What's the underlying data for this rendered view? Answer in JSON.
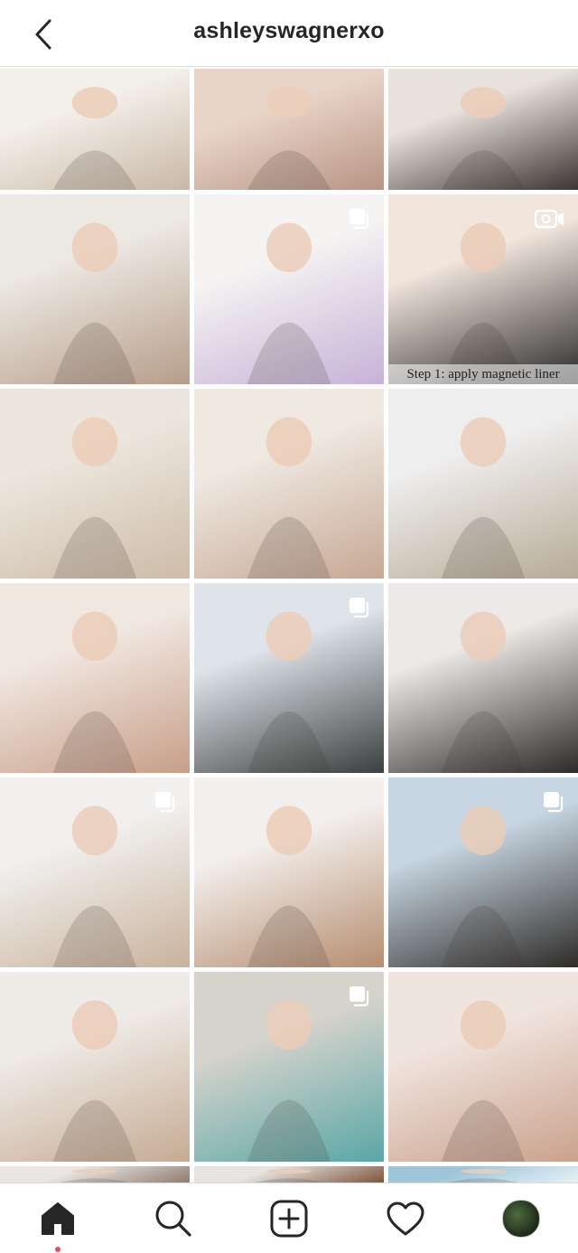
{
  "header": {
    "username": "ashleyswagnerxo",
    "back_icon": "chevron-left-icon"
  },
  "grid": {
    "tiles": [
      {
        "name": "post-1",
        "colors": [
          "#f3efe9",
          "#c9b8a6"
        ],
        "badge": null
      },
      {
        "name": "post-2",
        "colors": [
          "#e9d5c8",
          "#b89484"
        ],
        "badge": null
      },
      {
        "name": "post-3",
        "colors": [
          "#e8e2dc",
          "#3b3533"
        ],
        "badge": null
      },
      {
        "name": "post-4",
        "colors": [
          "#ece8e2",
          "#b79d8a"
        ],
        "badge": null
      },
      {
        "name": "post-5",
        "colors": [
          "#f5f4f2",
          "#c7b2d8"
        ],
        "badge": "multiple-posts-icon"
      },
      {
        "name": "post-6",
        "colors": [
          "#f1e5dc",
          "#2b2b2b"
        ],
        "badge": "video-icon",
        "caption": "Step 1: apply magnetic liner"
      },
      {
        "name": "post-7",
        "colors": [
          "#ede6de",
          "#cdbca8"
        ],
        "badge": null
      },
      {
        "name": "post-8",
        "colors": [
          "#efe9e2",
          "#c7a894"
        ],
        "badge": null
      },
      {
        "name": "post-9",
        "colors": [
          "#efeeee",
          "#b7ab96"
        ],
        "badge": null
      },
      {
        "name": "post-10",
        "colors": [
          "#f1e7e1",
          "#c79f88"
        ],
        "badge": null
      },
      {
        "name": "post-11",
        "colors": [
          "#dfe4ea",
          "#3b3f3f"
        ],
        "badge": "multiple-posts-icon"
      },
      {
        "name": "post-12",
        "colors": [
          "#ece9e8",
          "#2d2a28"
        ],
        "badge": null
      },
      {
        "name": "post-13",
        "colors": [
          "#f1f0ee",
          "#c9b29c"
        ],
        "badge": "multiple-posts-icon"
      },
      {
        "name": "post-14",
        "colors": [
          "#f3efec",
          "#b68e70"
        ],
        "badge": null
      },
      {
        "name": "post-15",
        "colors": [
          "#c7d6e2",
          "#2f2c29"
        ],
        "badge": "multiple-posts-icon"
      },
      {
        "name": "post-16",
        "colors": [
          "#efebe7",
          "#c6ab93"
        ],
        "badge": null
      },
      {
        "name": "post-17",
        "colors": [
          "#d6d3cc",
          "#5aa7a6"
        ],
        "badge": "multiple-posts-icon"
      },
      {
        "name": "post-18",
        "colors": [
          "#f0e4de",
          "#caa28d"
        ],
        "badge": null
      },
      {
        "name": "post-19",
        "colors": [
          "#e9e6e3",
          "#8d7a6d"
        ],
        "badge": null
      },
      {
        "name": "post-20",
        "colors": [
          "#e6e3e0",
          "#7a5138"
        ],
        "badge": null
      },
      {
        "name": "post-21",
        "colors": [
          "#9fc5d8",
          "#e9f2f6"
        ],
        "badge": null
      }
    ]
  },
  "tabbar": {
    "items": [
      {
        "name": "home-tab",
        "icon": "home-icon",
        "active": true
      },
      {
        "name": "search-tab",
        "icon": "search-icon",
        "active": false
      },
      {
        "name": "new-post-tab",
        "icon": "plus-square-icon",
        "active": false
      },
      {
        "name": "activity-tab",
        "icon": "heart-icon",
        "active": false
      },
      {
        "name": "profile-tab",
        "icon": "avatar",
        "active": false
      }
    ]
  }
}
